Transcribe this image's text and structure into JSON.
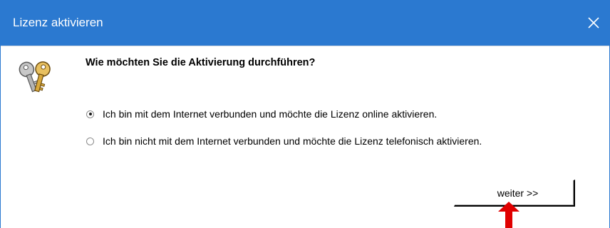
{
  "window": {
    "title": "Lizenz aktivieren",
    "title_bar_color": "#2b79d0",
    "icon": "keys-icon"
  },
  "dialog": {
    "question": "Wie möchten Sie die Aktivierung durchführen?",
    "options": [
      {
        "label": "Ich bin mit dem Internet verbunden und möchte die Lizenz online aktivieren.",
        "selected": true
      },
      {
        "label": "Ich bin nicht mit dem Internet verbunden und möchte die Lizenz telefonisch aktivieren.",
        "selected": false
      }
    ],
    "next_button_label": "weiter >>"
  },
  "annotation": {
    "pointer": "red-arrow-up-icon",
    "color": "#e00000"
  }
}
